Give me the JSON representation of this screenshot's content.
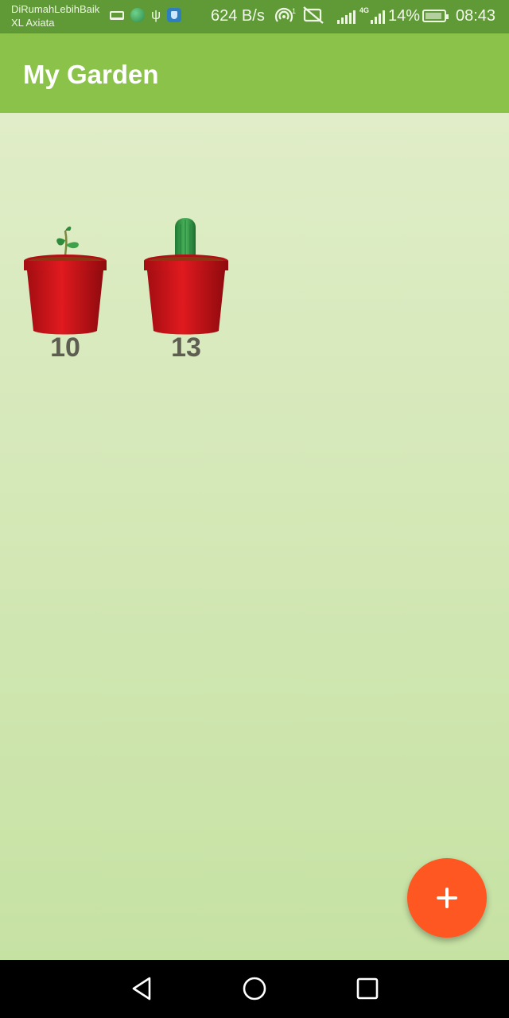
{
  "status_bar": {
    "carrier_line1": "DiRumahLebihBaik",
    "carrier_line2": "XL Axiata",
    "net_speed": "624 B/s",
    "hotspot_count": "1",
    "network_type": "4G",
    "battery": "14%",
    "time": "08:43",
    "icons_left": [
      "laptop-icon",
      "globe-icon",
      "usb-icon",
      "shield-icon"
    ],
    "icons_right": [
      "hotspot-icon",
      "no-sync-icon",
      "signal-icon",
      "signal-4g-icon",
      "battery-charging-icon"
    ]
  },
  "app_bar": {
    "title": "My Garden"
  },
  "plants": [
    {
      "kind": "sprout",
      "count": "10",
      "icon": "sprout-pot-icon"
    },
    {
      "kind": "cactus",
      "count": "13",
      "icon": "cactus-pot-icon"
    }
  ],
  "fab": {
    "icon": "plus-icon",
    "color": "#ff5722"
  },
  "navigation_bar": {
    "buttons": [
      "back-icon",
      "home-icon",
      "recents-icon"
    ]
  },
  "colors": {
    "app_bar": "#8bc34a",
    "status_bar": "#5f9a37",
    "background_top": "#e0edc8",
    "background_bottom": "#c6e2a3",
    "pot": "#c8141a",
    "count_text": "#5d5d52"
  }
}
